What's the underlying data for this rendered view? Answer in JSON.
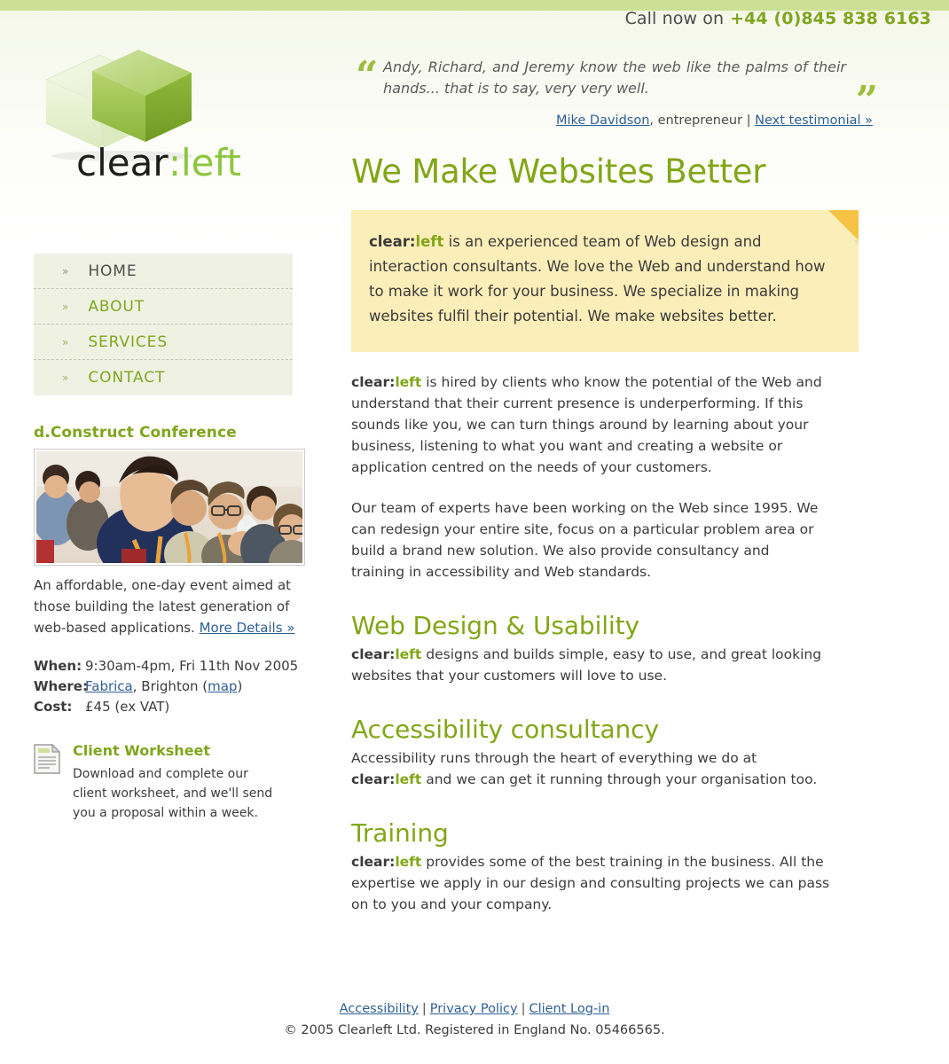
{
  "theme": {
    "green": "#82a617",
    "band_green": "#cbe095",
    "link_blue": "#2e5f96",
    "callout_yellow": "#fbeeb9",
    "fold_gold": "#f5c243",
    "nav_bg": "#eff2e3",
    "text": "#3c3c3c"
  },
  "header": {
    "phone_label": "Call now on",
    "phone_number": "+44 (0)845 838 6163"
  },
  "logo": {
    "word_clear": "clear",
    "word_colon": ":",
    "word_left": "left",
    "alt": "clear:left cube logo"
  },
  "nav": {
    "chevron": "»",
    "items": [
      {
        "label": "HOME",
        "current": true
      },
      {
        "label": "ABOUT",
        "current": false
      },
      {
        "label": "SERVICES",
        "current": false
      },
      {
        "label": "CONTACT",
        "current": false
      }
    ]
  },
  "testimonial": {
    "open_quote": "“",
    "close_quote": "”",
    "text": "Andy, Richard, and Jeremy know the web like the palms of their hands... that is to say, very very well.",
    "author": "Mike Davidson",
    "author_role": ", entrepreneur ",
    "divider": "| ",
    "next_link": "Next testimonial »"
  },
  "main": {
    "title": "We Make Websites Better",
    "callout": {
      "lead_brand_clear": "clear",
      "lead_brand_colon": ":",
      "lead_brand_left": "left",
      "text": " is an experienced team of Web design and interaction consultants. We love the Web and understand how to make it work for your business. We specialize in making websites fulfil their potential. We make websites better."
    },
    "paragraphs": [
      {
        "brand": true,
        "text": " is hired by clients who know the potential of the Web and understand that their current presence is underperforming. If this sounds like you, we can turn things around by learning about your business, listening to what you want and creating a website or application centred on the needs of your customers."
      },
      {
        "brand": false,
        "text": "Our team of experts have been working on the Web since 1995. We can redesign your entire site, focus on a particular problem area or build a brand new solution. We also provide consultancy and training in accessibility and Web standards."
      }
    ],
    "sections": [
      {
        "heading": "Web Design & Usability",
        "brand_lead": true,
        "text": " designs and builds simple, easy to use, and great looking websites that your customers will love to use.",
        "text_pre": "",
        "text_post": ""
      },
      {
        "heading": "Accessibility consultancy",
        "brand_lead": false,
        "text_pre": "Accessibility runs through the heart of everything we do at ",
        "text_post": " and we can get it running through your organisation too.",
        "text": ""
      },
      {
        "heading": "Training",
        "brand_lead": true,
        "text": " provides some of the best training in the business. All the expertise we apply in our design and consulting projects we can pass on to you and your company.",
        "text_pre": "",
        "text_post": ""
      }
    ]
  },
  "sidebar": {
    "conference": {
      "heading": "d.Construct Conference",
      "photo_alt": "Conference audience listening to a talk",
      "blurb": "An affordable, one-day event aimed at those building the latest generation of web-based applications. ",
      "more_link": "More Details »",
      "details": [
        {
          "key": "When:",
          "value": "9:30am-4pm, Fri 11th Nov 2005",
          "link": "",
          "link2": ""
        },
        {
          "key": "Where:",
          "value": ", Brighton (",
          "link": "Fabrica",
          "link2": "map",
          "value_end": ")"
        },
        {
          "key": "Cost:",
          "value": "£45 (ex VAT)",
          "link": "",
          "link2": ""
        }
      ]
    },
    "worksheet": {
      "icon": "document-icon",
      "title": "Client Worksheet",
      "text": "Download and complete our client worksheet, and we'll send you a proposal within a week."
    }
  },
  "footer": {
    "links": [
      "Accessibility",
      "Privacy Policy",
      "Client Log-in"
    ],
    "separator": "|",
    "copyright": "© 2005 Clearleft Ltd. Registered in England No. 05466565."
  }
}
